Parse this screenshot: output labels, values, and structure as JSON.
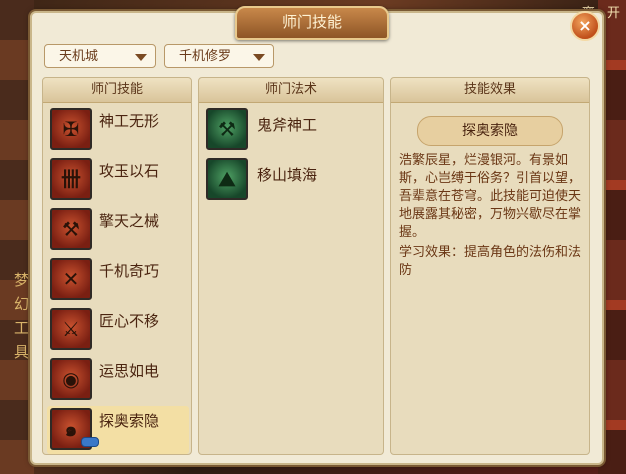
{
  "window": {
    "title": "师门技能",
    "close_label": "×"
  },
  "background": {
    "corner_text": "离 开",
    "left_text": "梦幻工具"
  },
  "filters": {
    "sect": "天机城",
    "branch": "千机修罗"
  },
  "columns": {
    "skills_header": "师门技能",
    "spells_header": "师门法术",
    "effect_header": "技能效果"
  },
  "skills": [
    {
      "label": "神工无形",
      "icon": "skill-icon-1"
    },
    {
      "label": "攻玉以石",
      "icon": "skill-icon-2"
    },
    {
      "label": "擎天之械",
      "icon": "skill-icon-3"
    },
    {
      "label": "千机奇巧",
      "icon": "skill-icon-4"
    },
    {
      "label": "匠心不移",
      "icon": "skill-icon-5"
    },
    {
      "label": "运思如电",
      "icon": "skill-icon-6"
    },
    {
      "label": "探奥索隐",
      "icon": "skill-icon-7",
      "selected": true
    }
  ],
  "spells": [
    {
      "label": "鬼斧神工",
      "icon": "spell-icon-axe"
    },
    {
      "label": "移山填海",
      "icon": "spell-icon-mountain"
    }
  ],
  "effect": {
    "name": "探奥索隐",
    "description": "浩繁辰星，烂漫银河。有景如斯，心岂缚于俗务？引首以望，吾辈意在苍穹。此技能可迫使天地展露其秘密，万物兴歇尽在掌握。",
    "learn": "学习效果：提高角色的法伤和法防"
  },
  "colors": {
    "panel": "#f1ead6",
    "accent": "#c04f1a",
    "text": "#4a2410"
  }
}
